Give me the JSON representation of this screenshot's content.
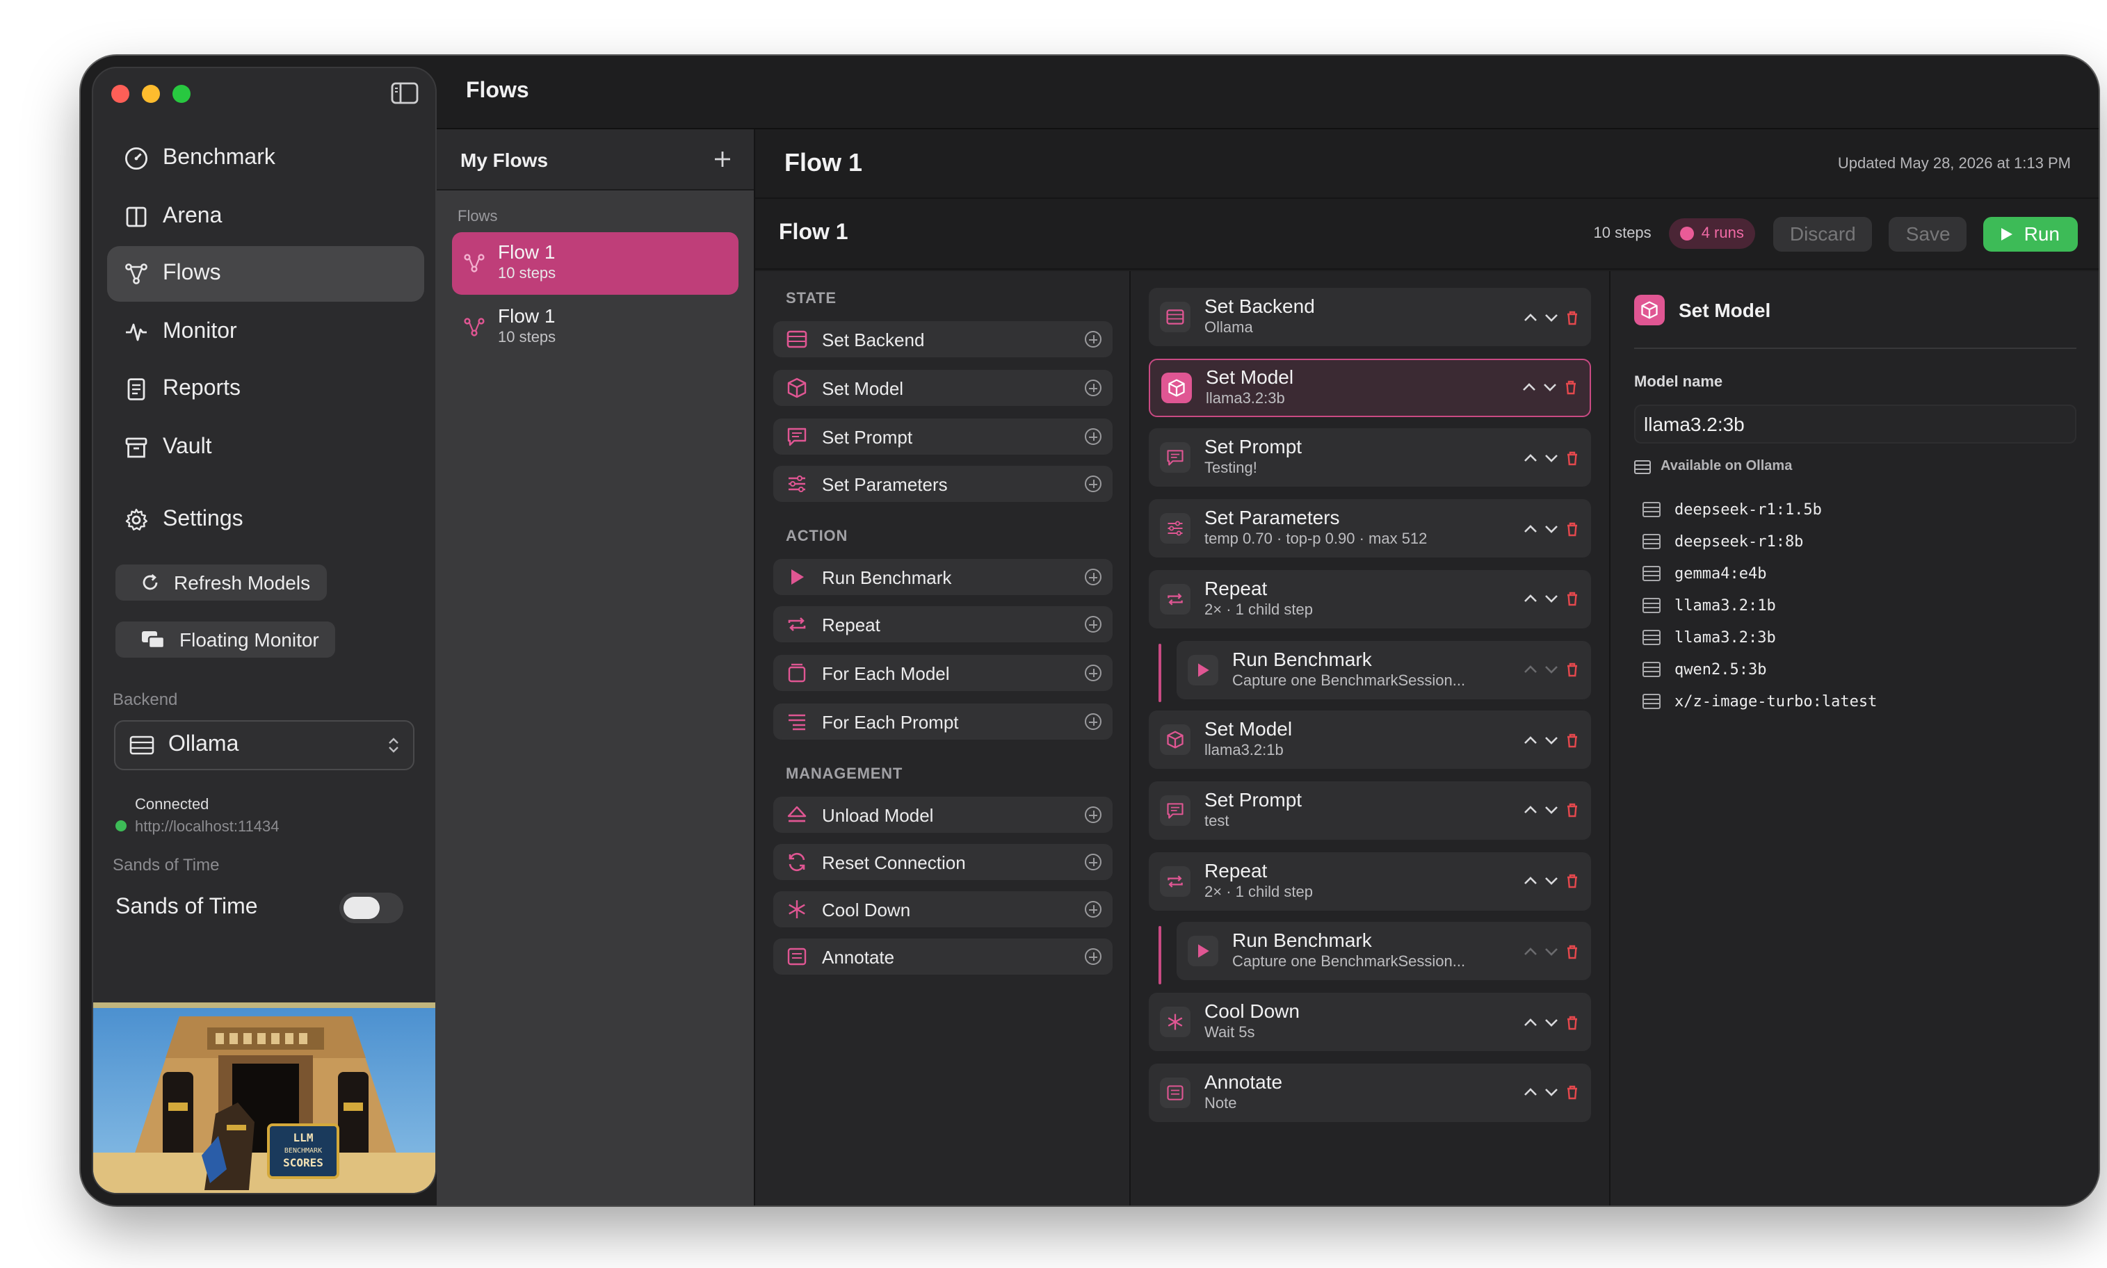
{
  "colors": {
    "accent": "#bf3e79",
    "accent_bright": "#e05693",
    "run_green": "#3dbb57",
    "connected": "#3dbb57"
  },
  "window": {
    "title": "Flows"
  },
  "sidebar": {
    "items": [
      {
        "label": "Benchmark",
        "icon": "gauge-icon"
      },
      {
        "label": "Arena",
        "icon": "columns-icon"
      },
      {
        "label": "Flows",
        "icon": "flow-icon",
        "active": true
      },
      {
        "label": "Monitor",
        "icon": "waveform-icon"
      },
      {
        "label": "Reports",
        "icon": "document-icon"
      },
      {
        "label": "Vault",
        "icon": "archive-icon"
      }
    ],
    "settings_label": "Settings",
    "refresh_label": "Refresh Models",
    "floating_label": "Floating Monitor",
    "backend_label": "Backend",
    "backend_value": "Ollama",
    "status_text": "Connected",
    "status_url": "http://localhost:11434",
    "sands_section": "Sands of Time",
    "sands_toggle_label": "Sands of Time",
    "sands_on": false,
    "art_sign": [
      "LLM",
      "BENCHMARK",
      "SCORES"
    ]
  },
  "flows_panel": {
    "title": "My Flows",
    "section": "Flows",
    "items": [
      {
        "name": "Flow 1",
        "steps": "10 steps",
        "active": true
      },
      {
        "name": "Flow 1",
        "steps": "10 steps",
        "active": false
      }
    ]
  },
  "main": {
    "title": "Flow 1",
    "updated": "Updated May 28, 2026 at 1:13 PM",
    "flow_name": "Flow 1",
    "steps_count": "10 steps",
    "runs": "4 runs",
    "discard": "Discard",
    "save": "Save",
    "run": "Run"
  },
  "palette": {
    "state_label": "STATE",
    "action_label": "ACTION",
    "management_label": "MANAGEMENT",
    "state": [
      "Set Backend",
      "Set Model",
      "Set Prompt",
      "Set Parameters"
    ],
    "action": [
      "Run Benchmark",
      "Repeat",
      "For Each Model",
      "For Each Prompt"
    ],
    "management": [
      "Unload Model",
      "Reset Connection",
      "Cool Down",
      "Annotate"
    ]
  },
  "steps": [
    {
      "name": "Set Backend",
      "sub": "Ollama",
      "icon": "server-icon"
    },
    {
      "name": "Set Model",
      "sub": "llama3.2:3b",
      "icon": "cube-icon",
      "selected": true
    },
    {
      "name": "Set Prompt",
      "sub": "Testing!",
      "icon": "message-icon"
    },
    {
      "name": "Set Parameters",
      "sub": "temp 0.70 · top-p 0.90 · max 512",
      "icon": "sliders-icon"
    },
    {
      "name": "Repeat",
      "sub": "2× · 1 child step",
      "icon": "repeat-icon"
    },
    {
      "name": "Run Benchmark",
      "sub": "Capture one BenchmarkSession...",
      "icon": "play-icon",
      "child": true
    },
    {
      "name": "Set Model",
      "sub": "llama3.2:1b",
      "icon": "cube-icon"
    },
    {
      "name": "Set Prompt",
      "sub": "test",
      "icon": "message-icon"
    },
    {
      "name": "Repeat",
      "sub": "2× · 1 child step",
      "icon": "repeat-icon"
    },
    {
      "name": "Run Benchmark",
      "sub": "Capture one BenchmarkSession...",
      "icon": "play-icon",
      "child": true
    },
    {
      "name": "Cool Down",
      "sub": "Wait 5s",
      "icon": "snowflake-icon"
    },
    {
      "name": "Annotate",
      "sub": "Note",
      "icon": "note-icon"
    }
  ],
  "inspector": {
    "title": "Set Model",
    "field_label": "Model name",
    "field_value": "llama3.2:3b",
    "available_label": "Available on Ollama",
    "models": [
      "deepseek-r1:1.5b",
      "deepseek-r1:8b",
      "gemma4:e4b",
      "llama3.2:1b",
      "llama3.2:3b",
      "qwen2.5:3b",
      "x/z-image-turbo:latest"
    ]
  }
}
